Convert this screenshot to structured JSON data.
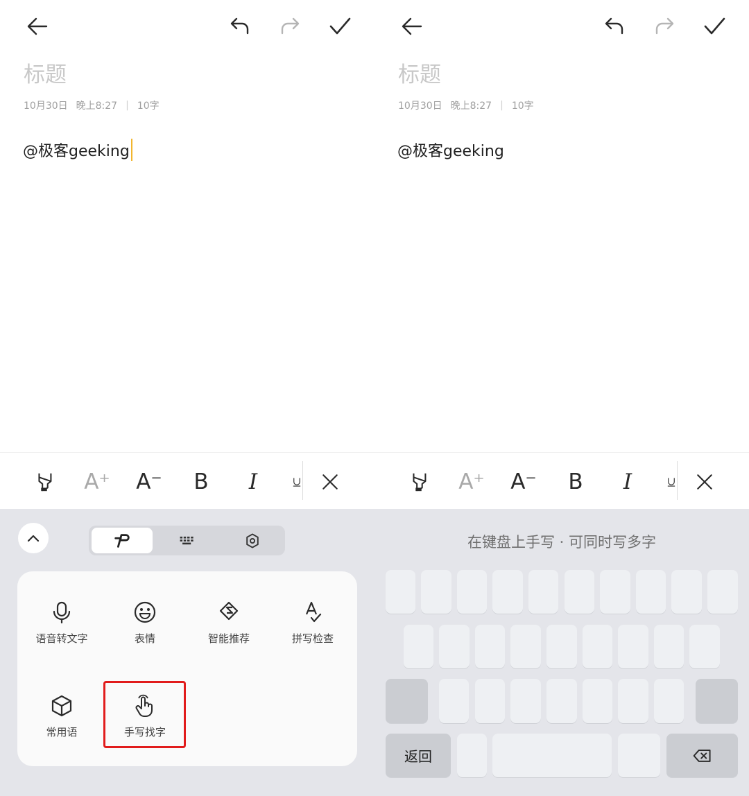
{
  "left": {
    "note": {
      "title_placeholder": "标题",
      "date": "10月30日",
      "time": "晚上8:27",
      "separator": "|",
      "word_count": "10字",
      "content": "@极客geeking"
    },
    "toolbar": {
      "font_larger_label": "A⁺",
      "font_smaller_label": "A⁻",
      "bold_label": "B",
      "italic_label": "I"
    },
    "features": [
      {
        "label": "语音转文字",
        "icon": "microphone-icon"
      },
      {
        "label": "表情",
        "icon": "smiley-icon"
      },
      {
        "label": "智能推荐",
        "icon": "smart-recommend-icon"
      },
      {
        "label": "拼写检查",
        "icon": "spell-check-icon"
      },
      {
        "label": "常用语",
        "icon": "cube-icon"
      },
      {
        "label": "手写找字",
        "icon": "hand-pointer-icon"
      }
    ],
    "highlight_color": "#e11c1c"
  },
  "right": {
    "note": {
      "title_placeholder": "标题",
      "date": "10月30日",
      "time": "晚上8:27",
      "separator": "|",
      "word_count": "10字",
      "content": "@极客geeking"
    },
    "toolbar": {
      "font_larger_label": "A⁺",
      "font_smaller_label": "A⁻",
      "bold_label": "B",
      "italic_label": "I"
    },
    "keyboard": {
      "hint": "在键盘上手写 · 可同时写多字",
      "return_label": "返回"
    }
  },
  "colors": {
    "caret": "#f2b62f",
    "keyboard_bg": "#e4e5ea"
  }
}
